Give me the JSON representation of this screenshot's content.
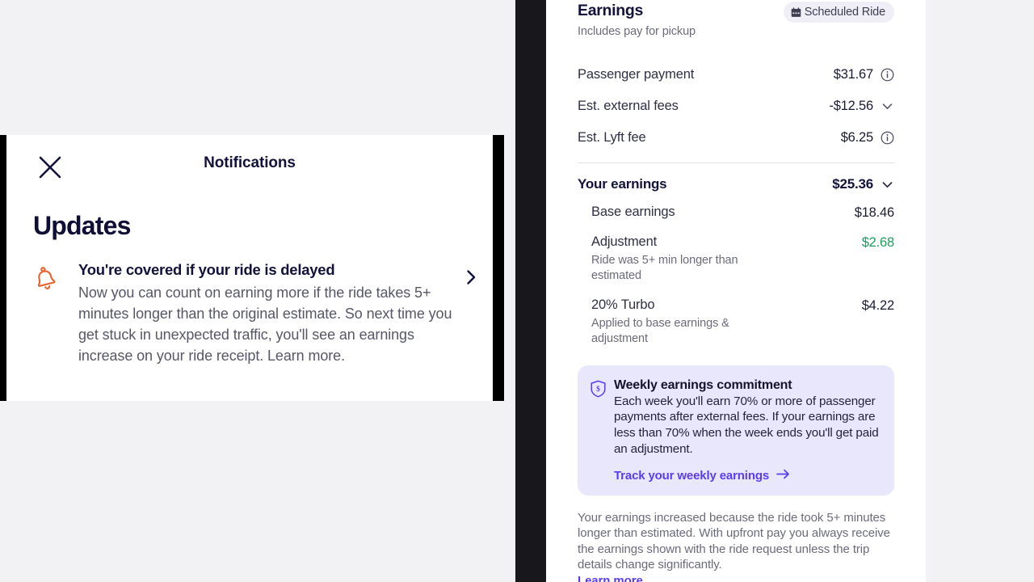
{
  "notifications_panel": {
    "close_icon": "close-x-icon",
    "nav_title": "Notifications",
    "section_title": "Updates",
    "items": [
      {
        "icon": "bell-icon",
        "title": "You're covered if your ride is delayed",
        "description": "Now you can count on earning more if the ride takes 5+ minutes longer than the original estimate. So next time you get stuck in unexpected traffic, you'll see an earnings increase on your ride receipt. Learn more.",
        "chevron": "chevron-right-icon"
      }
    ]
  },
  "earnings_panel": {
    "title": "Earnings",
    "subtitle": "Includes pay for pickup",
    "badge": {
      "icon": "calendar-icon",
      "label": "Scheduled Ride"
    },
    "fee_rows": [
      {
        "label": "Passenger payment",
        "value": "$31.67",
        "icon": "info-circle-icon"
      },
      {
        "label": "Est. external fees",
        "value": "-$12.56",
        "icon": "chevron-down-icon"
      },
      {
        "label": "Est. Lyft fee",
        "value": "$6.25",
        "icon": "info-circle-icon"
      }
    ],
    "total": {
      "label": "Your earnings",
      "value": "$25.36",
      "icon": "chevron-down-icon"
    },
    "breakdown": [
      {
        "label": "Base earnings",
        "note": "",
        "value": "$18.46",
        "color": "default"
      },
      {
        "label": "Adjustment",
        "note": "Ride was 5+ min longer than estimated",
        "value": "$2.68",
        "color": "green"
      },
      {
        "label": "20% Turbo",
        "note": "Applied to base earnings & adjustment",
        "value": "$4.22",
        "color": "default"
      }
    ],
    "commitment_card": {
      "icon": "shield-dollar-icon",
      "title": "Weekly earnings commitment",
      "text": "Each week you'll earn 70% or more of passenger payments after external fees. If your earnings are less than 70% when the week ends you'll get paid an adjustment.",
      "link_label": "Track your weekly earnings",
      "link_icon": "arrow-right-icon"
    },
    "footnote": {
      "text": "Your earnings increased because the ride took 5+ minutes longer than estimated. With upfront pay you always receive the earnings shown with the ride request unless the trip details change significantly.",
      "link_label": "Learn more"
    }
  },
  "colors": {
    "accent_purple": "#5b3cf5",
    "positive_green": "#1a9f5e",
    "bell_orange": "#e8622a",
    "navy_text": "#12123b",
    "muted_text": "#6b6b7b",
    "card_lavender": "#e9e7fb",
    "page_background": "#f2f2f4",
    "device_frame": "#17171c"
  }
}
